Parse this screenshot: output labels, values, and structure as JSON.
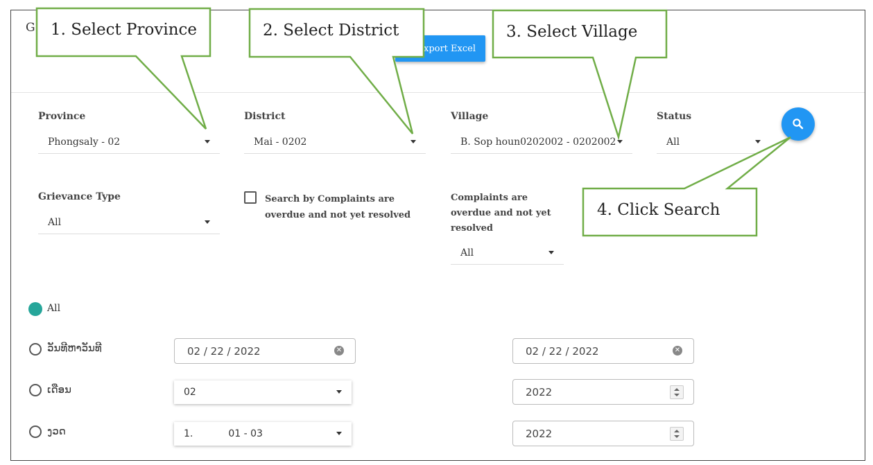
{
  "header": {
    "title_fragment": "G",
    "export_label": "Export Excel"
  },
  "filters": {
    "province": {
      "label": "Province",
      "value": "Phongsaly - 02"
    },
    "district": {
      "label": "District",
      "value": "Mai - 0202"
    },
    "village": {
      "label": "Village",
      "value": "B. Sop houn0202002 - 0202002"
    },
    "status": {
      "label": "Status",
      "value": "All"
    },
    "grievance_type": {
      "label": "Grievance Type",
      "value": "All"
    },
    "overdue_checkbox": {
      "label": "Search by Complaints are overdue and not yet resolved",
      "checked": false
    },
    "overdue_select": {
      "label": "Complaints are overdue and not yet resolved",
      "value": "All"
    }
  },
  "period": {
    "options": [
      {
        "label": "All",
        "selected": true
      },
      {
        "label": "ວັນທີຫາວັນທີ",
        "selected": false
      },
      {
        "label": "ເດືອນ",
        "selected": false
      },
      {
        "label": "ງວດ",
        "selected": false
      }
    ],
    "date_from": "02 / 22 / 2022",
    "date_to": "02 / 22 / 2022",
    "month_value": "02",
    "month_year": "2022",
    "quarter_num": "1.",
    "quarter_range": "01 - 03",
    "quarter_year": "2022"
  },
  "callouts": [
    {
      "text": "1. Select Province"
    },
    {
      "text": "2. Select District"
    },
    {
      "text": "3. Select Village"
    },
    {
      "text": "4. Click Search"
    }
  ],
  "colors": {
    "accent": "#2196f3",
    "radio_selected": "#26a69a",
    "callout_border": "#70ad47"
  },
  "icons": {
    "search": "search-icon",
    "clear": "clear-icon",
    "dropdown": "caret-down-icon"
  }
}
